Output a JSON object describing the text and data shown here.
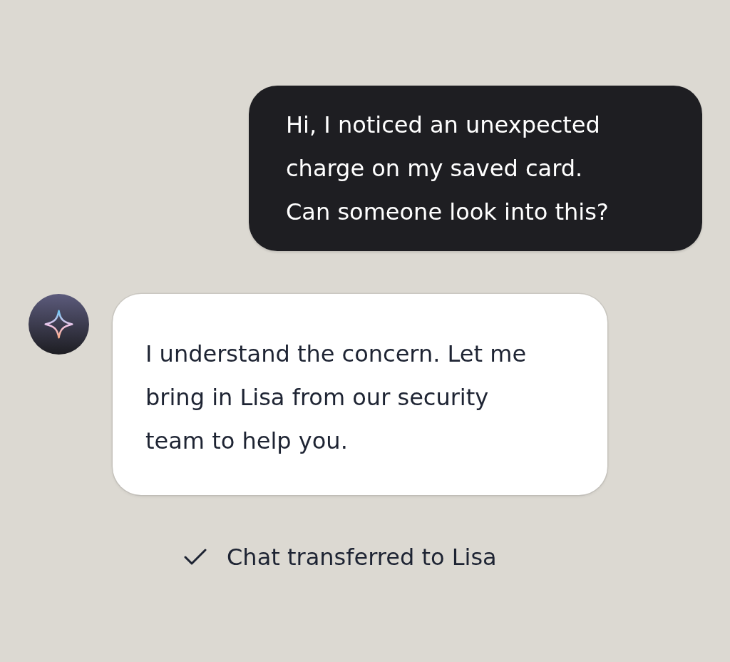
{
  "messages": [
    {
      "kind": "user",
      "text": "Hi, I noticed an unexpected charge on my saved card. Can someone look into this?"
    },
    {
      "kind": "agent",
      "text": "I understand the concern. Let me bring in Lisa from our security team to help you."
    },
    {
      "kind": "event",
      "text": "Chat transferred to Lisa"
    }
  ]
}
